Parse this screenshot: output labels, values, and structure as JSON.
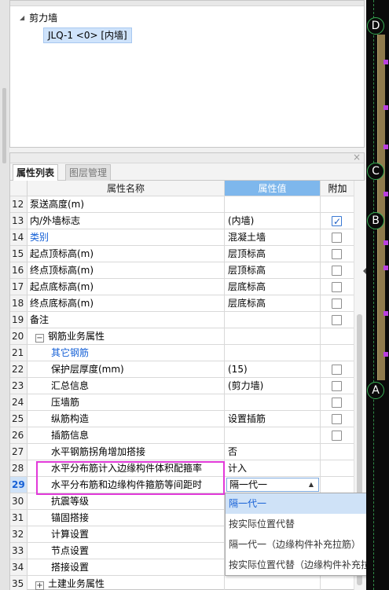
{
  "tree": {
    "root_label": "剪力墙",
    "leaf_label": "JLQ-1 <0> [内墙]"
  },
  "tabs": [
    {
      "label": "属性列表",
      "active": true
    },
    {
      "label": "图层管理",
      "active": false
    }
  ],
  "table": {
    "headers": {
      "name": "属性名称",
      "value": "属性值",
      "extra": "附加"
    },
    "rows": [
      {
        "num": "12",
        "name": "泵送高度(m)",
        "value": "",
        "check": null,
        "blue": false,
        "indent": 0
      },
      {
        "num": "13",
        "name": "内/外墙标志",
        "value": "(内墙)",
        "check": true,
        "blue": false,
        "indent": 0
      },
      {
        "num": "14",
        "name": "类别",
        "value": "混凝土墙",
        "check": false,
        "blue": true,
        "indent": 0
      },
      {
        "num": "15",
        "name": "起点顶标高(m)",
        "value": "层顶标高",
        "check": false,
        "blue": false,
        "indent": 0
      },
      {
        "num": "16",
        "name": "终点顶标高(m)",
        "value": "层顶标高",
        "check": false,
        "blue": false,
        "indent": 0
      },
      {
        "num": "17",
        "name": "起点底标高(m)",
        "value": "层底标高",
        "check": false,
        "blue": false,
        "indent": 0
      },
      {
        "num": "18",
        "name": "终点底标高(m)",
        "value": "层底标高",
        "check": false,
        "blue": false,
        "indent": 0
      },
      {
        "num": "19",
        "name": "备注",
        "value": "",
        "check": false,
        "blue": false,
        "indent": 0
      },
      {
        "num": "20",
        "name": "钢筋业务属性",
        "value": "",
        "check": null,
        "blue": false,
        "indent": 0,
        "expander": "−"
      },
      {
        "num": "21",
        "name": "其它钢筋",
        "value": "",
        "check": null,
        "blue": true,
        "indent": 2
      },
      {
        "num": "22",
        "name": "保护层厚度(mm)",
        "value": "(15)",
        "check": false,
        "blue": false,
        "indent": 2
      },
      {
        "num": "23",
        "name": "汇总信息",
        "value": "(剪力墙)",
        "check": false,
        "blue": false,
        "indent": 2
      },
      {
        "num": "24",
        "name": "压墙筋",
        "value": "",
        "check": false,
        "blue": false,
        "indent": 2
      },
      {
        "num": "25",
        "name": "纵筋构造",
        "value": "设置插筋",
        "check": false,
        "blue": false,
        "indent": 2
      },
      {
        "num": "26",
        "name": "插筋信息",
        "value": "",
        "check": false,
        "blue": false,
        "indent": 2
      },
      {
        "num": "27",
        "name": "水平钢筋拐角增加搭接",
        "value": "否",
        "check": null,
        "blue": false,
        "indent": 2
      },
      {
        "num": "28",
        "name": "水平分布筋计入边缘构件体积配箍率",
        "value": "计入",
        "check": null,
        "blue": false,
        "indent": 2
      },
      {
        "num": "29",
        "name": "水平分布筋和边缘构件箍筋等间距时",
        "value": "隔一代一",
        "check": null,
        "blue": false,
        "indent": 2,
        "selected": true,
        "dropdown": true
      },
      {
        "num": "30",
        "name": "抗震等级",
        "value": "",
        "check": null,
        "blue": false,
        "indent": 2
      },
      {
        "num": "31",
        "name": "锚固搭接",
        "value": "",
        "check": null,
        "blue": false,
        "indent": 2
      },
      {
        "num": "32",
        "name": "计算设置",
        "value": "",
        "check": null,
        "blue": false,
        "indent": 2
      },
      {
        "num": "33",
        "name": "节点设置",
        "value": "",
        "check": null,
        "blue": false,
        "indent": 2
      },
      {
        "num": "34",
        "name": "搭接设置",
        "value": "",
        "check": null,
        "blue": false,
        "indent": 2
      },
      {
        "num": "35",
        "name": "土建业务属性",
        "value": "",
        "check": null,
        "blue": false,
        "indent": 0,
        "expander": "+"
      }
    ]
  },
  "dropdown_options": [
    {
      "label": "隔一代一",
      "selected": true
    },
    {
      "label": "按实际位置代替",
      "selected": false
    },
    {
      "label": "隔一代一（边缘构件补充拉筋）",
      "selected": false
    },
    {
      "label": "按实际位置代替（边缘构件补充拉筋）",
      "selected": false
    }
  ],
  "axis_labels": [
    "D",
    "C",
    "B",
    "A"
  ],
  "colors": {
    "header_value_bg": "#7eb7ec",
    "link_blue": "#1560d6",
    "highlight": "#e23ad9",
    "axis_green": "#38b255"
  }
}
